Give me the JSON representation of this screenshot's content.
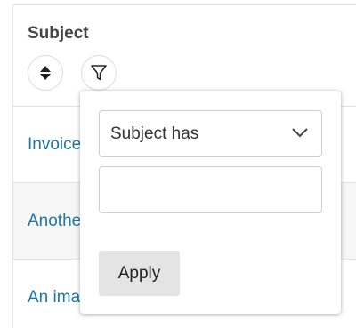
{
  "column": {
    "header": "Subject",
    "sort_icon": "sort-up-down-icon",
    "filter_icon": "funnel-filter-icon"
  },
  "rows": [
    {
      "text": "Invoice"
    },
    {
      "text": "Anothe"
    },
    {
      "text": "An ima"
    }
  ],
  "filter_popover": {
    "operator_selected": "Subject has",
    "operator_icon": "chevron-down-icon",
    "value": "",
    "placeholder": "",
    "apply_label": "Apply"
  },
  "colors": {
    "link": "#1f76a7",
    "header_text": "#444444",
    "alt_row_bg": "#f6f6f6",
    "button_bg": "#e4e4e4",
    "border": "#e2e2e2"
  }
}
